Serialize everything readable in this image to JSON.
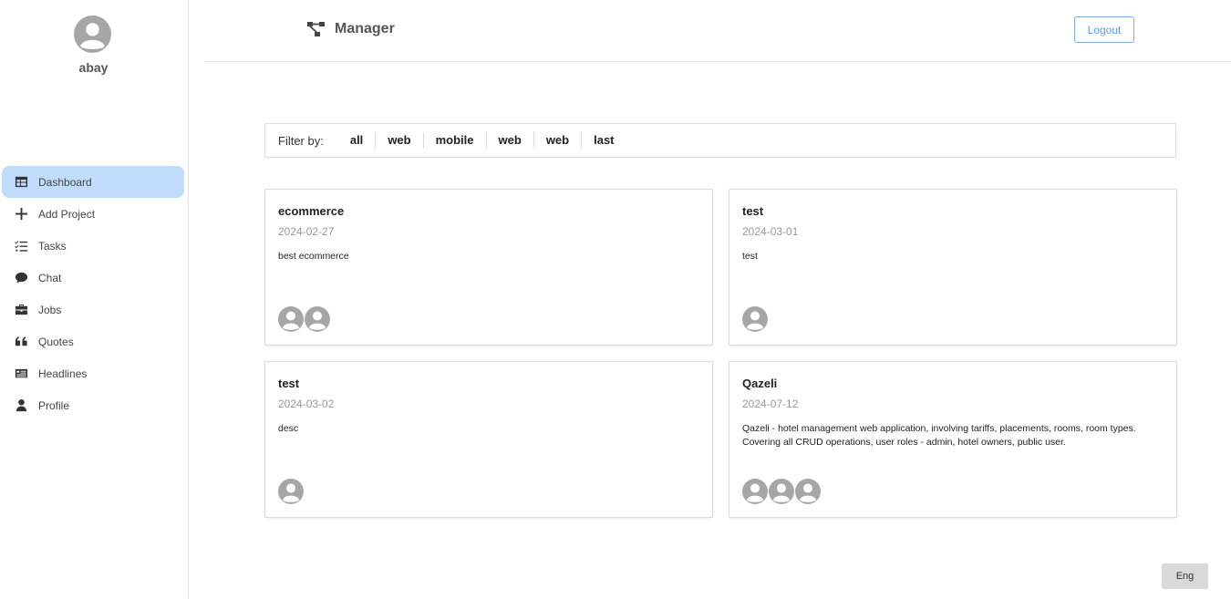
{
  "sidebar": {
    "username": "abay",
    "items": [
      {
        "label": "Dashboard",
        "icon": "table-icon",
        "active": true
      },
      {
        "label": "Add Project",
        "icon": "plus-icon"
      },
      {
        "label": "Tasks",
        "icon": "tasks-icon"
      },
      {
        "label": "Chat",
        "icon": "chat-icon"
      },
      {
        "label": "Jobs",
        "icon": "briefcase-icon"
      },
      {
        "label": "Quotes",
        "icon": "quote-icon"
      },
      {
        "label": "Headlines",
        "icon": "newspaper-icon"
      },
      {
        "label": "Profile",
        "icon": "person-icon"
      }
    ]
  },
  "header": {
    "brand": "Manager",
    "logout_label": "Logout"
  },
  "filter": {
    "label": "Filter by:",
    "options": [
      "all",
      "web",
      "mobile",
      "web",
      "web",
      "last"
    ]
  },
  "projects": [
    {
      "title": "ecommerce",
      "date": "2024-02-27",
      "description": "best ecommerce",
      "members": 2
    },
    {
      "title": "test",
      "date": "2024-03-01",
      "description": "test",
      "members": 1
    },
    {
      "title": "test",
      "date": "2024-03-02",
      "description": "desc",
      "members": 1
    },
    {
      "title": "Qazeli",
      "date": "2024-07-12",
      "description": "Qazeli - hotel management web application, involving tariffs, placements, rooms, room types. Covering all CRUD operations, user roles - admin, hotel owners, public user.",
      "members": 3
    }
  ],
  "language_label": "Eng",
  "colors": {
    "active_nav": "#c2dcfb",
    "logout_border": "#7ab0ec",
    "avatar_gray": "#a6a6a6"
  }
}
